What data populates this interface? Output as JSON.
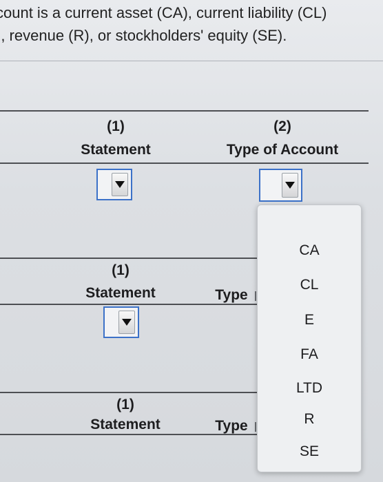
{
  "instructions": {
    "line1": "count is a current asset (CA), current liability (CL)",
    "line2": "), revenue (R), or stockholders' equity (SE)."
  },
  "rows": [
    {
      "statement_num": "(1)",
      "statement_label": "Statement",
      "type_num": "(2)",
      "type_label": "Type of Account"
    },
    {
      "statement_num": "(1)",
      "statement_label": "Statement",
      "type_label": "Type"
    },
    {
      "statement_num": "(1)",
      "statement_label": "Statement",
      "type_label": "Type"
    }
  ],
  "type_dropdown_options": [
    "CA",
    "CL",
    "E",
    "FA",
    "LTD",
    "R",
    "SE"
  ],
  "colors": {
    "accent_border": "#3b71c8",
    "line": "#4d4f53"
  }
}
